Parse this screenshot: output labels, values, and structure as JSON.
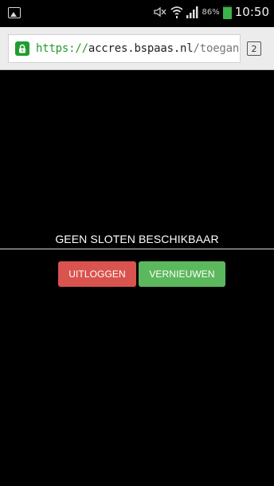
{
  "status_bar": {
    "battery_percent": "86%",
    "time": "10:50",
    "icons": [
      "gallery-icon",
      "mute-icon",
      "wifi-icon",
      "signal-icon",
      "battery-icon"
    ],
    "battery_color": "#3bb44a"
  },
  "browser": {
    "url_scheme": "https",
    "url_separator": "://",
    "url_host": "accres.bspaas.nl",
    "url_path": "/toegang",
    "tab_count": "2",
    "secure_color": "#1f9d2f"
  },
  "overlay": {
    "message": "GEEN SLOTEN BESCHIKBAAR",
    "logout_label": "UITLOGGEN",
    "refresh_label": "VERNIEUWEN",
    "logout_color": "#d9534f",
    "refresh_color": "#5cb85c"
  }
}
